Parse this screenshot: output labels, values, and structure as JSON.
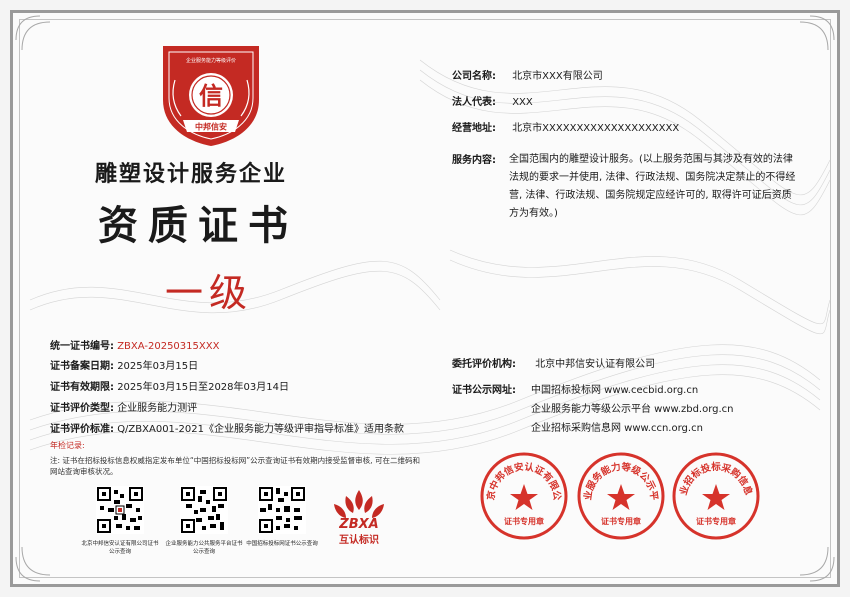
{
  "certificate": {
    "badge": {
      "org_name": "企业服务能力等级评价",
      "glyph": "信",
      "banner": "中邦信安"
    },
    "title_line1": "雕塑设计服务企业",
    "title_line2": "资质证书",
    "grade": "一级",
    "left_fields": [
      {
        "key": "统一证书编号:",
        "value": "ZBXA-20250315XXX",
        "value_red": true
      },
      {
        "key": "证书备案日期:",
        "value": "2025年03月15日"
      },
      {
        "key": "证书有效期限:",
        "value": "2025年03月15日至2028年03月14日"
      },
      {
        "key": "证书评价类型:",
        "value": "企业服务能力测评"
      },
      {
        "key": "证书评价标准:",
        "value": "Q/ZBXA001-2021《企业服务能力等级评审指导标准》适用条款"
      }
    ],
    "annual_check_label": "年检记录:",
    "note": "注: 证书在招标投标信息权威指定发布单位“中国招标投标网”公示查询证书有效期内接受监督审核, 可在二维码和网站查询审核状况。",
    "qr_codes": [
      {
        "caption": "北京中邦信安认证有限公司证书公示查询"
      },
      {
        "caption": "企业服务能力公共服务平台证书公示查询"
      },
      {
        "caption": "中国招标投标网证书公示查询"
      }
    ],
    "logo": {
      "mark": "ZBXA",
      "text": "互认标识"
    },
    "right_fields": [
      {
        "key": "公司名称:",
        "value": "北京市XXX有限公司"
      },
      {
        "key": "法人代表:",
        "value": "XXX"
      },
      {
        "key": "经营地址:",
        "value": "北京市XXXXXXXXXXXXXXXXXXXX"
      }
    ],
    "scope_key": "服务内容:",
    "scope_text": "全国范围内的雕塑设计服务。(以上服务范围与其涉及有效的法律法规的要求一并使用, 法律、行政法规、国务院决定禁止的不得经营, 法律、行政法规、国务院规定应经许可的, 取得许可证后资质方为有效。)",
    "evaluator_key": "委托评价机构:",
    "evaluator_value": "北京中邦信安认证有限公司",
    "publish_key": "证书公示网址:",
    "publish_sites": [
      "中国招标投标网 www.cecbid.org.cn",
      "企业服务能力等级公示平台 www.zbd.org.cn",
      "企业招标采购信息网 www.ccn.org.cn"
    ],
    "seals": [
      {
        "ring": "北京中邦信安认证有限公司",
        "bottom": "证书专用章"
      },
      {
        "ring": "企业服务能力等级公示平台",
        "bottom": "证书专用章"
      },
      {
        "ring": "企业招标投标采购信息网",
        "bottom": "证书专用章"
      }
    ],
    "colors": {
      "accent_red": "#c42a23",
      "frame": "#9a9a9a"
    }
  }
}
